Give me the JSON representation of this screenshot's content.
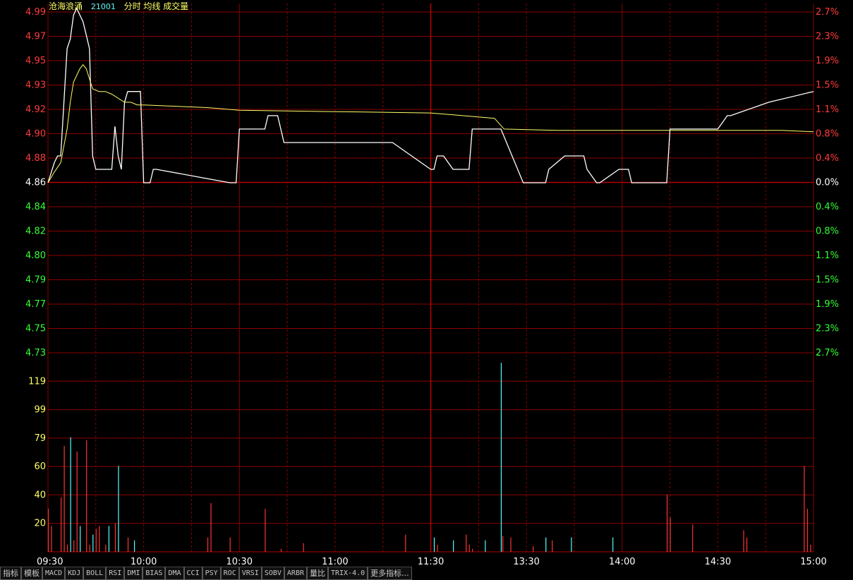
{
  "header": {
    "stock_name": "沧海浪涌",
    "stock_code": "21001",
    "indicators": "分时 均线 成交量"
  },
  "colors": {
    "background": "#000000",
    "grid": "#8b0000",
    "grid_strong": "#b40000",
    "up": "#ff3b3b",
    "down": "#33ff33",
    "neutral": "#ffffff",
    "price_line": "#ffffff",
    "avg_line": "#ffff66",
    "volume_up": "#ff3333",
    "volume_down": "#55ffff",
    "axis_time": "#ffffff",
    "volume_axis": "#ffff66",
    "name": "#ffff66",
    "code": "#55ffff"
  },
  "chart_data": {
    "type": "line",
    "title": "",
    "base_price": 4.86,
    "price_axis": {
      "left_labels": [
        "4.99",
        "4.97",
        "4.95",
        "4.93",
        "4.92",
        "4.90",
        "4.88",
        "4.86",
        "4.84",
        "4.82",
        "4.80",
        "4.79",
        "4.77",
        "4.75",
        "4.73"
      ],
      "right_labels": [
        "2.7%",
        "2.3%",
        "1.9%",
        "1.5%",
        "1.1%",
        "0.8%",
        "0.4%",
        "0.0%",
        "0.4%",
        "0.8%",
        "1.1%",
        "1.5%",
        "1.9%",
        "2.3%",
        "2.7%"
      ],
      "ylim": [
        4.73,
        4.99
      ]
    },
    "time_axis": {
      "labels": [
        "09:30",
        "10:00",
        "10:30",
        "11:00",
        "11:30",
        "13:30",
        "14:00",
        "14:30",
        "15:00"
      ],
      "total_minutes": 240
    },
    "volume_axis": {
      "labels": [
        "119",
        "99",
        "79",
        "60",
        "40",
        "20"
      ],
      "ylim": [
        0,
        139
      ]
    },
    "series": [
      {
        "name": "分时",
        "x": [
          0,
          2,
          3,
          4,
          6,
          7,
          8,
          9,
          10,
          11,
          12,
          13,
          14,
          15,
          16,
          17,
          18,
          19,
          20,
          21,
          22,
          23,
          24,
          25,
          26,
          27,
          28,
          29,
          30,
          32,
          33,
          34,
          57,
          59,
          60,
          68,
          69,
          71,
          72,
          74,
          108,
          120,
          121,
          122,
          124,
          127,
          128,
          132,
          133,
          141,
          142,
          149,
          150,
          156,
          157,
          162,
          168,
          169,
          172,
          173,
          179,
          182,
          183,
          193,
          194,
          195,
          209,
          210,
          213,
          214,
          226,
          240
        ],
        "y": [
          4.86,
          4.875,
          4.88,
          4.88,
          4.96,
          4.967,
          4.985,
          4.99,
          4.985,
          4.98,
          4.97,
          4.96,
          4.88,
          4.87,
          4.87,
          4.87,
          4.87,
          4.87,
          4.87,
          4.902,
          4.88,
          4.87,
          4.92,
          4.928,
          4.928,
          4.928,
          4.928,
          4.928,
          4.86,
          4.86,
          4.87,
          4.87,
          4.86,
          4.86,
          4.9,
          4.9,
          4.91,
          4.91,
          4.91,
          4.89,
          4.89,
          4.87,
          4.87,
          4.88,
          4.88,
          4.87,
          4.87,
          4.87,
          4.9,
          4.9,
          4.9,
          4.86,
          4.86,
          4.86,
          4.87,
          4.88,
          4.88,
          4.87,
          4.86,
          4.86,
          4.87,
          4.87,
          4.86,
          4.86,
          4.86,
          4.9,
          4.9,
          4.9,
          4.91,
          4.91,
          4.92,
          4.928
        ]
      },
      {
        "name": "均线",
        "x": [
          0,
          2,
          4,
          6,
          7,
          8,
          9,
          10,
          11,
          12,
          14,
          16,
          18,
          20,
          24,
          26,
          28,
          30,
          40,
          50,
          60,
          90,
          120,
          130,
          140,
          143,
          160,
          180,
          195,
          200,
          210,
          230,
          240
        ],
        "y": [
          4.86,
          4.868,
          4.875,
          4.9,
          4.92,
          4.935,
          4.94,
          4.945,
          4.948,
          4.945,
          4.93,
          4.928,
          4.928,
          4.926,
          4.92,
          4.92,
          4.918,
          4.918,
          4.917,
          4.916,
          4.914,
          4.913,
          4.912,
          4.91,
          4.908,
          4.9,
          4.899,
          4.899,
          4.899,
          4.899,
          4.899,
          4.899,
          4.898
        ]
      }
    ],
    "volume": {
      "x": [
        0,
        1,
        4,
        5,
        6,
        7,
        8,
        9,
        10,
        12,
        13,
        14,
        15,
        16,
        18,
        19,
        21,
        22,
        25,
        27,
        50,
        51,
        57,
        68,
        73,
        80,
        112,
        121,
        122,
        127,
        131,
        132,
        133,
        137,
        142,
        142.5,
        145,
        152,
        156,
        158,
        164,
        177,
        194,
        195,
        202,
        218,
        219,
        237,
        238,
        239
      ],
      "v": [
        30,
        18,
        38,
        74,
        5,
        80,
        8,
        70,
        18,
        78,
        5,
        12,
        16,
        18,
        5,
        18,
        20,
        60,
        10,
        8,
        10,
        34,
        10,
        30,
        2,
        6,
        12,
        10,
        5,
        8,
        12,
        5,
        2,
        8,
        132,
        11,
        10,
        4,
        10,
        8,
        10,
        10,
        40,
        24,
        19,
        15,
        10,
        60,
        30,
        5
      ],
      "color": [
        "up",
        "up",
        "up",
        "up",
        "up",
        "down",
        "up",
        "up",
        "down",
        "up",
        "up",
        "down",
        "up",
        "up",
        "up",
        "down",
        "up",
        "down",
        "up",
        "down",
        "up",
        "up",
        "up",
        "up",
        "up",
        "up",
        "up",
        "down",
        "up",
        "down",
        "up",
        "up",
        "up",
        "down",
        "down",
        "up",
        "up",
        "up",
        "down",
        "up",
        "down",
        "down",
        "up",
        "up",
        "up",
        "up",
        "up",
        "up",
        "up",
        "up"
      ]
    }
  },
  "tabs": [
    "指标",
    "模板",
    "MACD",
    "KDJ",
    "BOLL",
    "RSI",
    "DMI",
    "BIAS",
    "DMA",
    "CCI",
    "PSY",
    "ROC",
    "VRSI",
    "SOBV",
    "ARBR",
    "量比",
    "TRIX-4.0",
    "更多指标..."
  ]
}
